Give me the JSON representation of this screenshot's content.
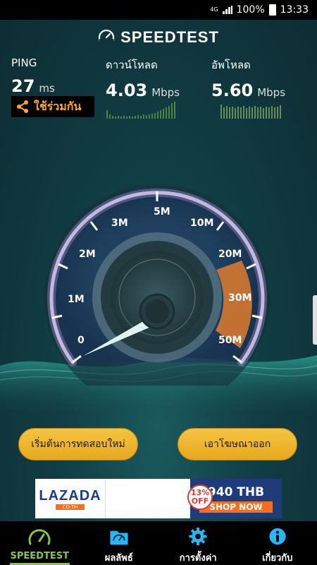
{
  "status_bar": {
    "network": "4G",
    "battery": "100%",
    "time": "13:33"
  },
  "app": {
    "title": "SPEEDTEST"
  },
  "metrics": {
    "ping": {
      "label": "PING",
      "value": "27",
      "unit": "ms"
    },
    "download": {
      "label": "ดาวน์โหลด",
      "value": "4.03",
      "unit": "Mbps"
    },
    "upload": {
      "label": "อัพโหลด",
      "value": "5.60",
      "unit": "Mbps"
    }
  },
  "share": {
    "label": "ใช้ร่วมกัน"
  },
  "gauge": {
    "ticks": [
      "0",
      "1M",
      "2M",
      "3M",
      "5M",
      "10M",
      "20M",
      "30M",
      "50M"
    ],
    "needle_value": "0.5"
  },
  "buttons": {
    "restart": "เริ่มต้นการทดสอบใหม่",
    "remove_ads": "เอาโฆษณาออก"
  },
  "ad": {
    "brand": "LAZADA",
    "brand_sub": "CO.TH",
    "discount": "13%",
    "discount_suffix": "OFF",
    "price": "940 THB",
    "cta": "SHOP NOW"
  },
  "nav": {
    "items": [
      {
        "label": "SPEEDTEST",
        "icon": "speedometer-icon"
      },
      {
        "label": "ผลลัพธ์",
        "icon": "folder-icon"
      },
      {
        "label": "การตั้งค่า",
        "icon": "gear-icon"
      },
      {
        "label": "เกี่ยวกับ",
        "icon": "info-icon"
      }
    ]
  },
  "colors": {
    "accent_green": "#8bc34a",
    "accent_orange": "#ffa726",
    "gauge_ring": "#b39ddb"
  }
}
